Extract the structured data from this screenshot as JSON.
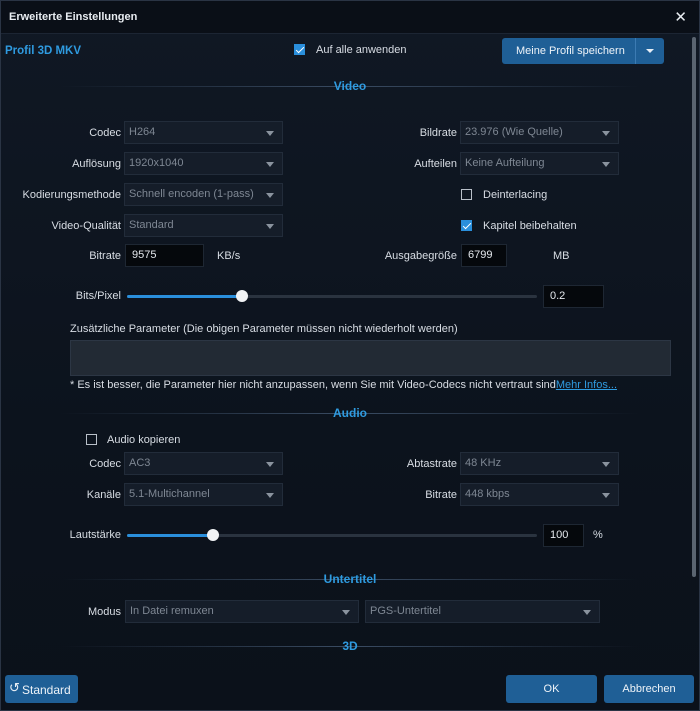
{
  "window": {
    "title": "Erweiterte Einstellungen"
  },
  "profile": {
    "name": "Profil 3D MKV",
    "apply_all_label": "Auf alle anwenden",
    "apply_all_checked": true,
    "save_label": "Meine Profil speichern"
  },
  "video": {
    "section_title": "Video",
    "codec_label": "Codec",
    "codec_value": "H264",
    "framerate_label": "Bildrate",
    "framerate_value": "23.976 (Wie Quelle)",
    "resolution_label": "Auflösung",
    "resolution_value": "1920x1040",
    "split_label": "Aufteilen",
    "split_value": "Keine Aufteilung",
    "encoding_label": "Kodierungsmethode",
    "encoding_value": "Schnell encoden (1-pass)",
    "deinterlacing_label": "Deinterlacing",
    "deinterlacing_checked": false,
    "quality_label": "Video-Qualität",
    "quality_value": "Standard",
    "keep_chapters_label": "Kapitel beibehalten",
    "keep_chapters_checked": true,
    "bitrate_label": "Bitrate",
    "bitrate_value": "9575",
    "bitrate_unit": "KB/s",
    "output_size_label": "Ausgabegröße",
    "output_size_value": "6799",
    "output_size_unit": "MB",
    "bits_pixel_label": "Bits/Pixel",
    "bits_pixel_value": "0.2",
    "bits_pixel_fraction": 0.28,
    "extra_params_label": "Zusätzliche Parameter (Die obigen Parameter müssen nicht wiederholt werden)",
    "extra_params_value": "",
    "note": "* Es ist besser, die Parameter hier nicht anzupassen, wenn Sie mit Video-Codecs nicht vertraut sind",
    "more_info": "Mehr Infos..."
  },
  "audio": {
    "section_title": "Audio",
    "copy_label": "Audio kopieren",
    "copy_checked": false,
    "codec_label": "Codec",
    "codec_value": "AC3",
    "samplerate_label": "Abtastrate",
    "samplerate_value": "48 KHz",
    "channels_label": "Kanäle",
    "channels_value": "5.1-Multichannel",
    "bitrate_label": "Bitrate",
    "bitrate_value": "448 kbps",
    "volume_label": "Lautstärke",
    "volume_value": "100",
    "volume_unit": "%",
    "volume_fraction": 0.21
  },
  "subtitle": {
    "section_title": "Untertitel",
    "mode_label": "Modus",
    "mode_value": "In Datei remuxen",
    "type_value": "PGS-Untertitel"
  },
  "three_d": {
    "section_title": "3D"
  },
  "footer": {
    "default_label": "Standard",
    "ok_label": "OK",
    "cancel_label": "Abbrechen"
  },
  "colors": {
    "accent": "#2a8fdc",
    "button": "#1f5f96",
    "section_title": "#2f9be0"
  }
}
